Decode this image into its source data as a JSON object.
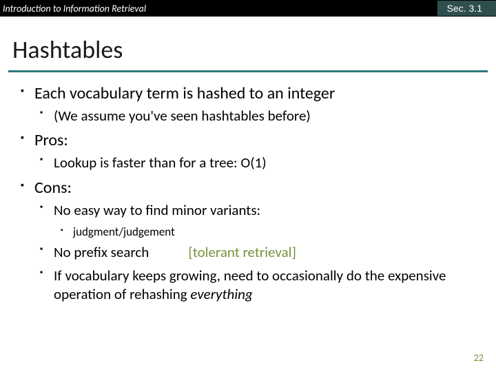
{
  "topbar": {
    "left": "Introduction to Information Retrieval",
    "right": "Sec. 3.1"
  },
  "title": "Hashtables",
  "bullets": {
    "b1": "Each vocabulary term is hashed to an integer",
    "b1a": "(We assume you've seen hashtables before)",
    "b2": "Pros:",
    "b2a": "Lookup is faster than for a tree: O(1)",
    "b3": "Cons:",
    "b3a": "No easy way to find minor variants:",
    "b3a1": "judgment/judgement",
    "b3b_pre": "No prefix search",
    "b3b_bracket": "[tolerant retrieval]",
    "b3c_pre": "If vocabulary keeps growing, need to occasionally do the expensive operation of rehashing ",
    "b3c_em": "everything"
  },
  "pagenum": "22"
}
